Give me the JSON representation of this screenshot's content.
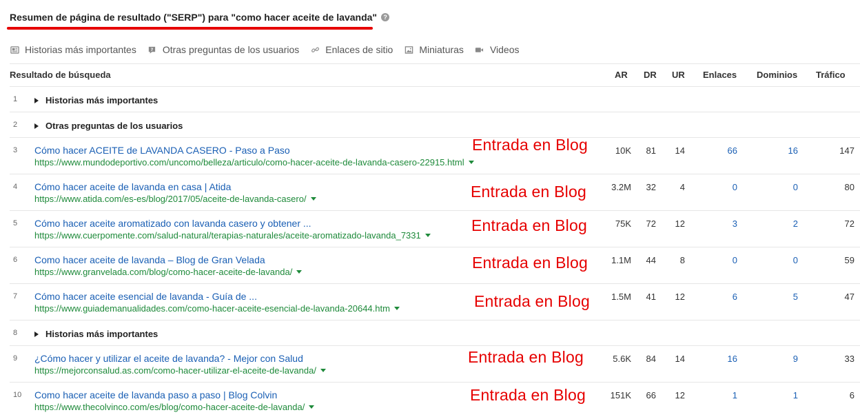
{
  "header": {
    "title": "Resumen de página de resultado (\"SERP\") para \"como hacer aceite de lavanda\"",
    "help_icon": "help-circle-icon"
  },
  "features": [
    {
      "label": "Historias más importantes",
      "icon": "news-icon"
    },
    {
      "label": "Otras preguntas de los usuarios",
      "icon": "question-icon"
    },
    {
      "label": "Enlaces de sitio",
      "icon": "link-icon"
    },
    {
      "label": "Miniaturas",
      "icon": "image-icon"
    },
    {
      "label": "Videos",
      "icon": "video-icon"
    }
  ],
  "table": {
    "columns": {
      "result": "Resultado de búsqueda",
      "ar": "AR",
      "dr": "DR",
      "ur": "UR",
      "links": "Enlaces",
      "domains": "Dominios",
      "traffic": "Tráfico"
    },
    "rows": [
      {
        "type": "group",
        "num": "1",
        "label": "Historias más importantes"
      },
      {
        "type": "group",
        "num": "2",
        "label": "Otras preguntas de los usuarios"
      },
      {
        "type": "result",
        "num": "3",
        "title": "Cómo hacer ACEITE de LAVANDA CASERO - Paso a Paso",
        "url": "https://www.mundodeportivo.com/uncomo/belleza/articulo/como-hacer-aceite-de-lavanda-casero-22915.html",
        "annotation": "Entrada en Blog",
        "ar": "10K",
        "dr": "81",
        "ur": "14",
        "links": "66",
        "domains": "16",
        "traffic": "147"
      },
      {
        "type": "result",
        "num": "4",
        "title": "Cómo hacer aceite de lavanda en casa | Atida",
        "url": "https://www.atida.com/es-es/blog/2017/05/aceite-de-lavanda-casero/",
        "annotation": "Entrada en Blog",
        "ar": "3.2M",
        "dr": "32",
        "ur": "4",
        "links": "0",
        "domains": "0",
        "traffic": "80"
      },
      {
        "type": "result",
        "num": "5",
        "title": "Cómo hacer aceite aromatizado con lavanda casero y obtener ...",
        "url": "https://www.cuerpomente.com/salud-natural/terapias-naturales/aceite-aromatizado-lavanda_7331",
        "annotation": "Entrada en Blog",
        "ar": "75K",
        "dr": "72",
        "ur": "12",
        "links": "3",
        "domains": "2",
        "traffic": "72"
      },
      {
        "type": "result",
        "num": "6",
        "title": "Como hacer aceite de lavanda – Blog de Gran Velada",
        "url": "https://www.granvelada.com/blog/como-hacer-aceite-de-lavanda/",
        "annotation": "Entrada en Blog",
        "ar": "1.1M",
        "dr": "44",
        "ur": "8",
        "links": "0",
        "domains": "0",
        "traffic": "59"
      },
      {
        "type": "result",
        "num": "7",
        "title": "Cómo hacer aceite esencial de lavanda - Guía de ...",
        "url": "https://www.guiademanualidades.com/como-hacer-aceite-esencial-de-lavanda-20644.htm",
        "annotation": "Entrada en Blog",
        "ar": "1.5M",
        "dr": "41",
        "ur": "12",
        "links": "6",
        "domains": "5",
        "traffic": "47"
      },
      {
        "type": "group",
        "num": "8",
        "label": "Historias más importantes"
      },
      {
        "type": "result",
        "num": "9",
        "title": "¿Cómo hacer y utilizar el aceite de lavanda? - Mejor con Salud",
        "url": "https://mejorconsalud.as.com/como-hacer-utilizar-el-aceite-de-lavanda/",
        "annotation": "Entrada en Blog",
        "ar": "5.6K",
        "dr": "84",
        "ur": "14",
        "links": "16",
        "domains": "9",
        "traffic": "33"
      },
      {
        "type": "result",
        "num": "10",
        "title": "Como hacer aceite de lavanda paso a paso | Blog Colvin",
        "url": "https://www.thecolvinco.com/es/blog/como-hacer-aceite-de-lavanda/",
        "annotation": "Entrada en Blog",
        "ar": "151K",
        "dr": "66",
        "ur": "12",
        "links": "1",
        "domains": "1",
        "traffic": "6"
      }
    ]
  },
  "colors": {
    "link_blue": "#1a5fb4",
    "url_green": "#1e8a3a",
    "annotation_red": "#e60000"
  }
}
